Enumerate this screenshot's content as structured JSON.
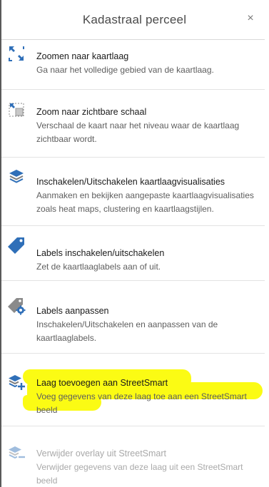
{
  "header": {
    "title": "Kadastraal perceel",
    "close_glyph": "×"
  },
  "colors": {
    "icon_blue": "#2f6fb8",
    "icon_grey": "#7d7d7d",
    "highlight": "#fbfb14",
    "disabled_text": "#a9a9a9"
  },
  "items": [
    {
      "icon": "zoom-to-layer-icon",
      "title": "Zoomen naar kaartlaag",
      "description": "Ga naar het volledige gebied van de kaartlaag."
    },
    {
      "icon": "zoom-to-visible-scale-icon",
      "title": "Zoom naar zichtbare schaal",
      "description": "Verschaal de kaart naar het niveau waar de kaartlaag zichtbaar wordt."
    },
    {
      "icon": "layers-icon",
      "title": "Inschakelen/Uitschakelen kaartlaagvisualisaties",
      "description": "Aanmaken en bekijken aangepaste kaartlaagvisualisaties zoals heat maps, clustering en kaartlaagstijlen."
    },
    {
      "icon": "label-tag-icon",
      "title": "Labels inschakelen/uitschakelen",
      "description": "Zet de kaartlaaglabels aan of uit."
    },
    {
      "icon": "label-settings-icon",
      "title": "Labels aanpassen",
      "description": "Inschakelen/Uitschakelen en aanpassen van de kaartlaaglabels."
    },
    {
      "icon": "add-layer-icon",
      "title": "Laag toevoegen aan StreetSmart",
      "description": "Voeg gegevens van deze laag toe aan een StreetSmart beeld",
      "highlighted": true
    },
    {
      "icon": "remove-overlay-icon",
      "title": "Verwijder overlay uit StreetSmart",
      "description": "Verwijder gegevens van deze laag uit een StreetSmart beeld",
      "disabled": true
    }
  ]
}
